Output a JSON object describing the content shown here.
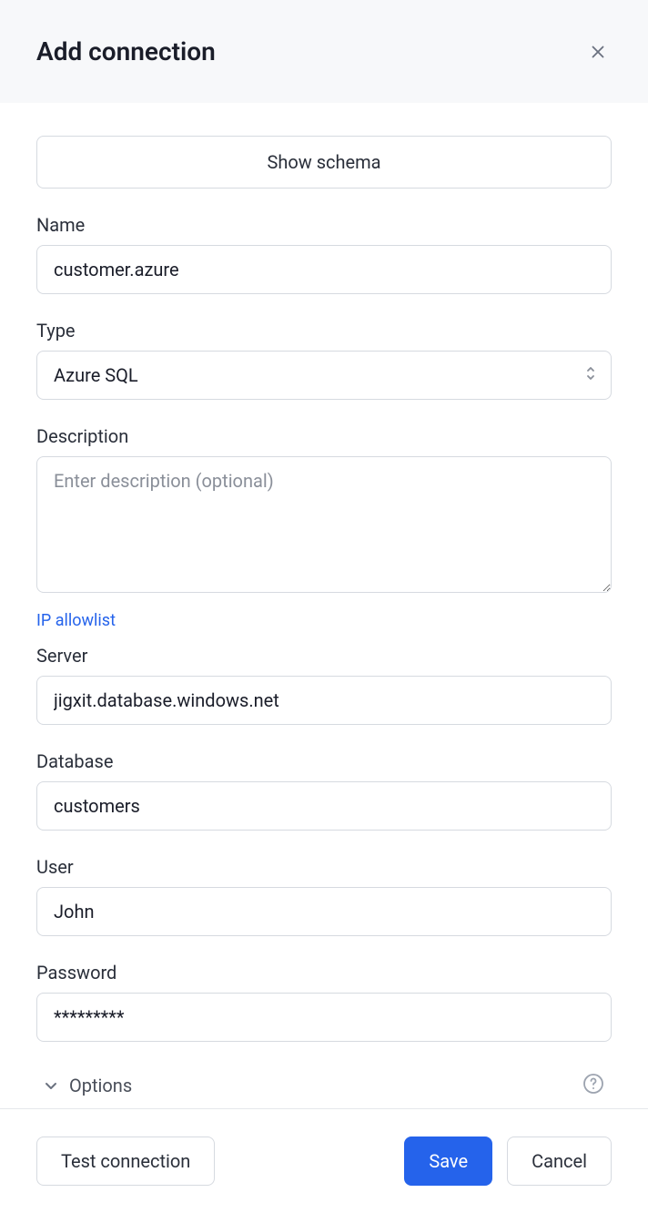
{
  "header": {
    "title": "Add connection"
  },
  "show_schema_label": "Show schema",
  "fields": {
    "name": {
      "label": "Name",
      "value": "customer.azure"
    },
    "type": {
      "label": "Type",
      "value": "Azure SQL"
    },
    "description": {
      "label": "Description",
      "placeholder": "Enter description (optional)",
      "value": ""
    },
    "server": {
      "label": "Server",
      "value": "jigxit.database.windows.net"
    },
    "database": {
      "label": "Database",
      "value": "customers"
    },
    "user": {
      "label": "User",
      "value": "John"
    },
    "password": {
      "label": "Password",
      "value": "*********"
    }
  },
  "ip_allowlist_label": "IP allowlist",
  "options_label": "Options",
  "footer": {
    "test_label": "Test connection",
    "save_label": "Save",
    "cancel_label": "Cancel"
  }
}
